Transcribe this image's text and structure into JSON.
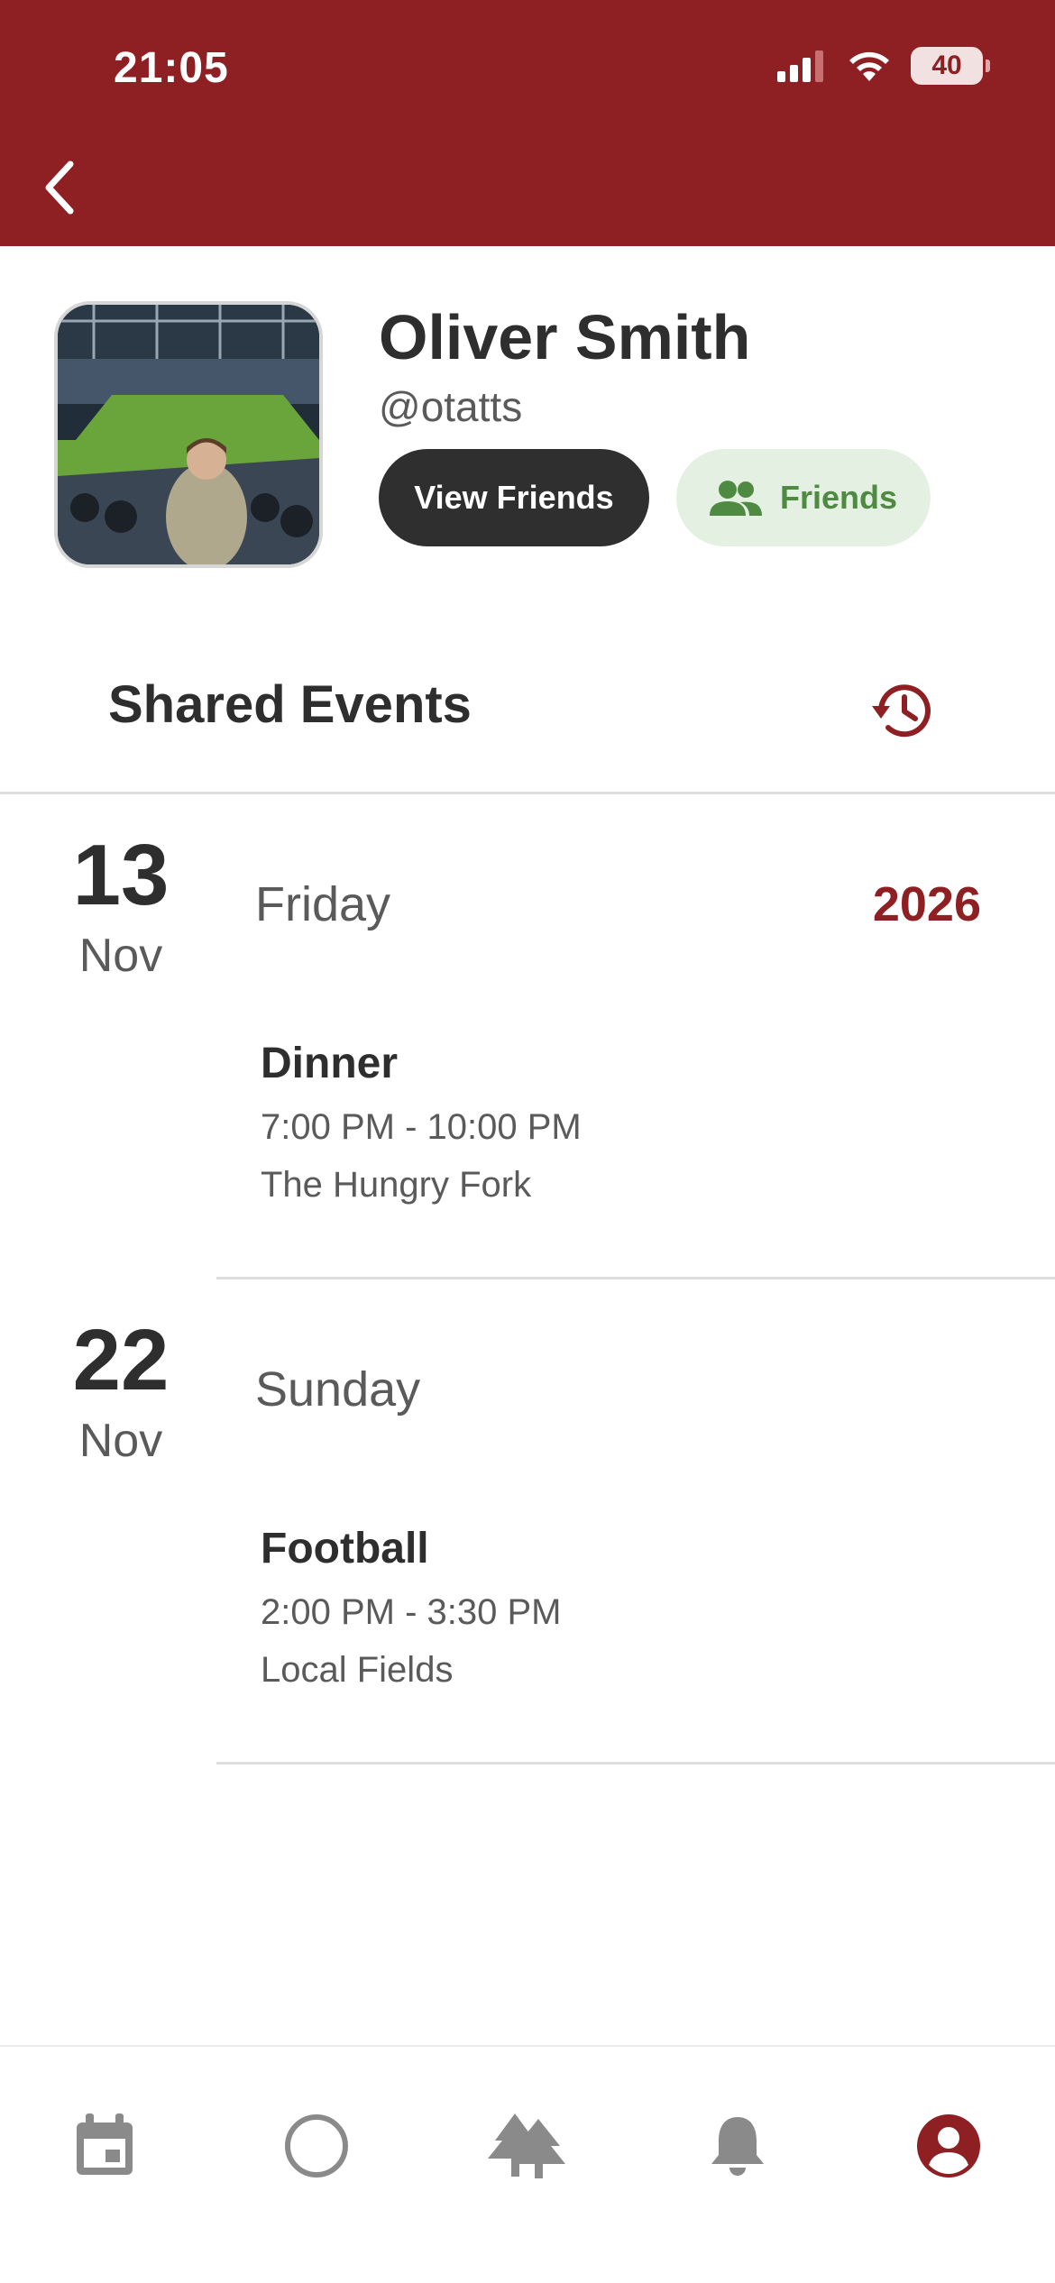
{
  "status_bar": {
    "time": "21:05",
    "battery": "40"
  },
  "profile": {
    "name": "Oliver Smith",
    "handle": "@otatts",
    "view_friends_label": "View Friends",
    "friends_status_label": "Friends"
  },
  "shared_events": {
    "title": "Shared Events",
    "days": [
      {
        "day": "13",
        "month": "Nov",
        "weekday": "Friday",
        "year": "2026",
        "event": {
          "title": "Dinner",
          "time": "7:00 PM - 10:00 PM",
          "location": "The Hungry Fork"
        }
      },
      {
        "day": "22",
        "month": "Nov",
        "weekday": "Sunday",
        "year": "",
        "event": {
          "title": "Football",
          "time": "2:00 PM - 3:30 PM",
          "location": "Local Fields"
        }
      }
    ]
  },
  "tabs": [
    {
      "icon": "calendar-icon",
      "active": false
    },
    {
      "icon": "circle-icon",
      "active": false
    },
    {
      "icon": "trees-icon",
      "active": false
    },
    {
      "icon": "bell-icon",
      "active": false
    },
    {
      "icon": "account-icon",
      "active": true
    }
  ],
  "colors": {
    "brand": "#8e2024",
    "friends_badge_bg": "#e4f1e2",
    "friends_badge_text": "#4f8a43",
    "tab_inactive": "#8a8a8a"
  }
}
